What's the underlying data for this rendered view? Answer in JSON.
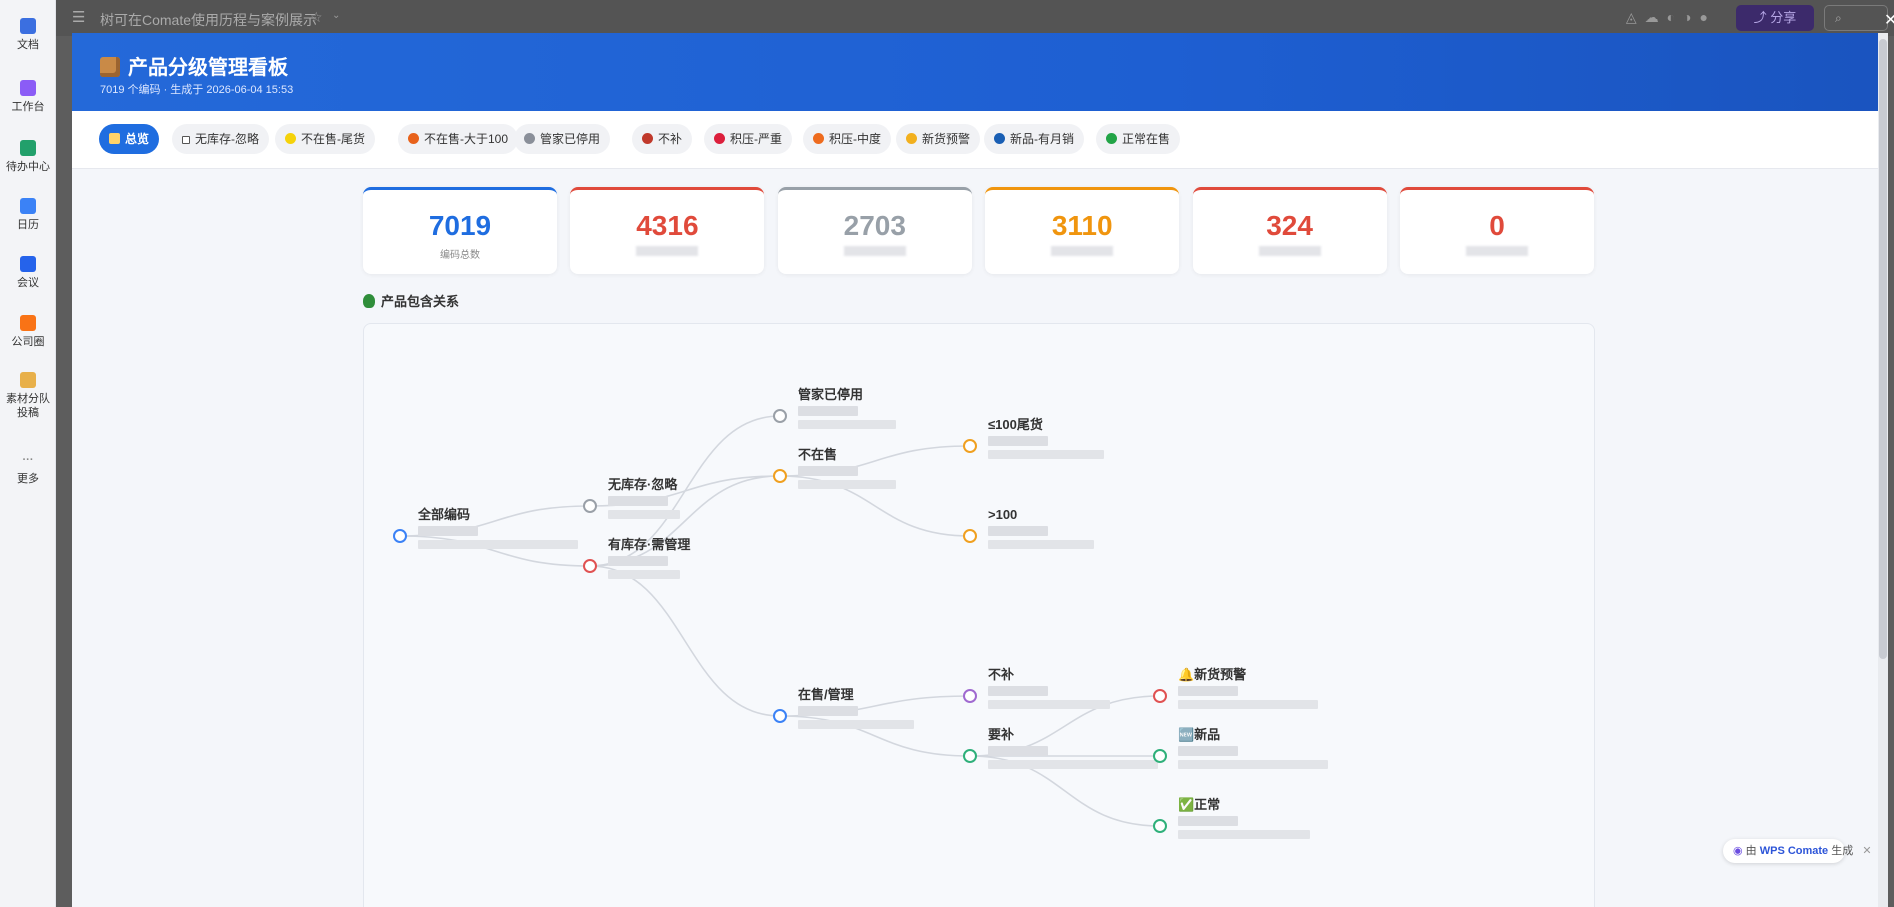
{
  "app": {
    "doc_title": "树可在Comate使用历程与案例展示",
    "share_label": "分享",
    "rail": [
      {
        "label": "文档",
        "color": "#3b6fe0"
      },
      {
        "label": "工作台",
        "color": "#8b5cf6"
      },
      {
        "label": "待办中心",
        "color": "#22a06b"
      },
      {
        "label": "日历",
        "color": "#3b82f6"
      },
      {
        "label": "会议",
        "color": "#2563eb"
      },
      {
        "label": "公司圈",
        "color": "#f97316"
      },
      {
        "label": "素材分队投稿",
        "color": "#e8b04a"
      },
      {
        "label": "更多",
        "color": "#888888"
      }
    ]
  },
  "dashboard": {
    "title": "产品分级管理看板",
    "subtitle": "7019 个编码 · 生成于 2026-06-04 15:53",
    "filters": [
      {
        "label": "总览",
        "dot": "",
        "active": true
      },
      {
        "label": "无库存-忽略",
        "dot": "#ffffff",
        "active": false
      },
      {
        "label": "不在售-尾货",
        "dot": "#f5d20a",
        "active": false
      },
      {
        "label": "不在售-大于100",
        "dot": "#e8621b",
        "active": false
      },
      {
        "label": "管家已停用",
        "dot": "#8a8f99",
        "active": false
      },
      {
        "label": "不补",
        "dot": "#c0392b",
        "active": false
      },
      {
        "label": "积压-严重",
        "dot": "#dc1f3c",
        "active": false
      },
      {
        "label": "积压-中度",
        "dot": "#ee6b1e",
        "active": false
      },
      {
        "label": "新货预警",
        "dot": "#f2b01e",
        "active": false
      },
      {
        "label": "新品-有月销",
        "dot": "#1a5fb4",
        "active": false
      },
      {
        "label": "正常在售",
        "dot": "#22a447",
        "active": false
      }
    ],
    "stats": [
      {
        "value": "7019",
        "label": "编码总数",
        "color": "#1f6de0"
      },
      {
        "value": "4316",
        "label": "",
        "color": "#e04a3b"
      },
      {
        "value": "2703",
        "label": "",
        "color": "#98a0a8"
      },
      {
        "value": "3110",
        "label": "",
        "color": "#f0950e"
      },
      {
        "value": "324",
        "label": "",
        "color": "#e04a3b"
      },
      {
        "value": "0",
        "label": "",
        "color": "#e04a3b"
      }
    ],
    "section_title": "产品包含关系",
    "tree_nodes": [
      {
        "id": "root",
        "label": "全部编码",
        "color": "#3b82f6"
      },
      {
        "id": "nostock",
        "label": "无库存·忽略",
        "color": "#9aa0a8"
      },
      {
        "id": "stock",
        "label": "有库存·需管理",
        "color": "#e05252"
      },
      {
        "id": "stopped",
        "label": "管家已停用",
        "color": "#9aa0a8"
      },
      {
        "id": "notsale",
        "label": "不在售",
        "color": "#f0a020"
      },
      {
        "id": "onsale",
        "label": "在售/管理",
        "color": "#3b82f6"
      },
      {
        "id": "tail",
        "label": "≤100尾货",
        "color": "#f0a020"
      },
      {
        "id": "over",
        "label": ">100",
        "color": "#f0a020"
      },
      {
        "id": "nobu",
        "label": "不补",
        "color": "#a06ad0"
      },
      {
        "id": "yaobu",
        "label": "要补",
        "color": "#2fb07a"
      },
      {
        "id": "alert",
        "label": "🔔新货预警",
        "color": "#e05252"
      },
      {
        "id": "newp",
        "label": "🆕新品",
        "color": "#2fb07a"
      },
      {
        "id": "normal",
        "label": "✅正常",
        "color": "#2fb07a"
      }
    ],
    "badge": {
      "prefix": "由",
      "brand": "WPS Comate",
      "suffix": "生成"
    }
  }
}
